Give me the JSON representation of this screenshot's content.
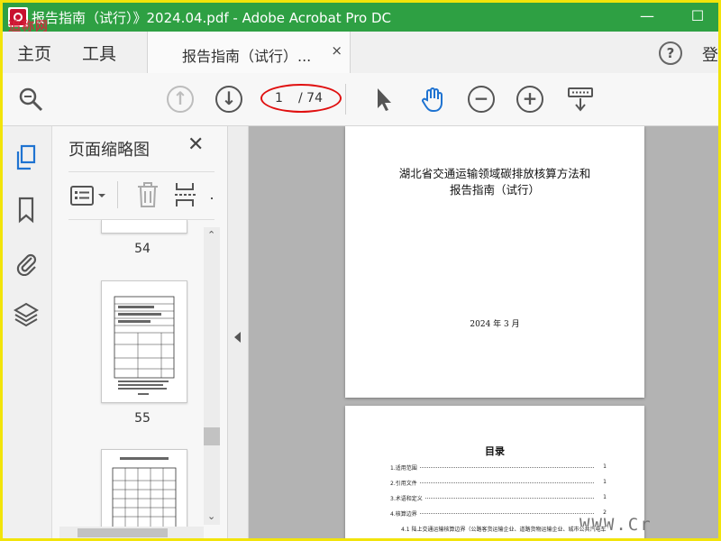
{
  "window": {
    "title": "报告指南（试行）》2024.04.pdf - Adobe Acrobat Pro DC",
    "watermark_top_left": "追称网",
    "minimize": "—",
    "maximize": "☐"
  },
  "tabs": {
    "home": "主页",
    "tools": "工具",
    "document": "报告指南（试行）...",
    "close": "×",
    "help": "?",
    "signin": "登"
  },
  "toolbar": {
    "current_page": "1",
    "total_pages": "/ 74"
  },
  "panel": {
    "title": "页面缩略图",
    "close": "✕",
    "thumbnails": [
      {
        "number": "54"
      },
      {
        "number": "55"
      }
    ]
  },
  "document": {
    "page1": {
      "title_line1": "湖北省交通运输领域碳排放核算方法和",
      "title_line2": "报告指南（试行）",
      "date": "2024 年 3 月"
    },
    "page2": {
      "toc_title": "目录",
      "toc": [
        {
          "text": "1.适用范围",
          "page": "1"
        },
        {
          "text": "2.引用文件",
          "page": "1"
        },
        {
          "text": "3.术语和定义",
          "page": "1"
        },
        {
          "text": "4.核算边界",
          "page": "2"
        },
        {
          "text": "4.1 陆上交通运输核算边界（公路客货运输企业、道路货物运输企业、城市公共汽电车",
          "page": ""
        }
      ]
    }
  },
  "watermark_bottom_right": "WWW.Cr"
}
